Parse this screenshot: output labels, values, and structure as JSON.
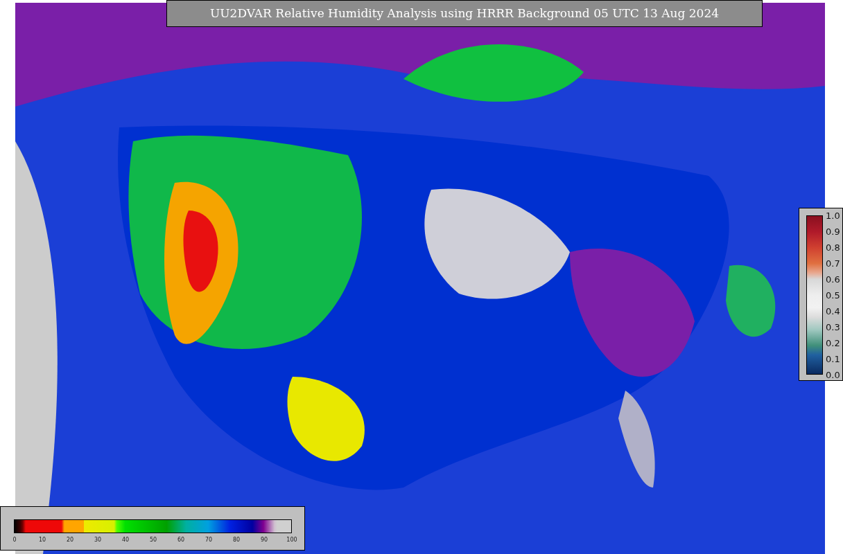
{
  "title": "UU2DVAR Relative Humidity Analysis using HRRR Background 05 UTC 13 Aug 2024",
  "analysis_colorbar": {
    "ticks": [
      "0",
      "10",
      "20",
      "30",
      "40",
      "50",
      "60",
      "70",
      "80",
      "90",
      "100"
    ]
  },
  "observation_colorbar": {
    "ticks": [
      "1.0",
      "0.9",
      "0.8",
      "0.7",
      "0.6",
      "0.5",
      "0.4",
      "0.3",
      "0.2",
      "0.1",
      "0.0"
    ]
  }
}
